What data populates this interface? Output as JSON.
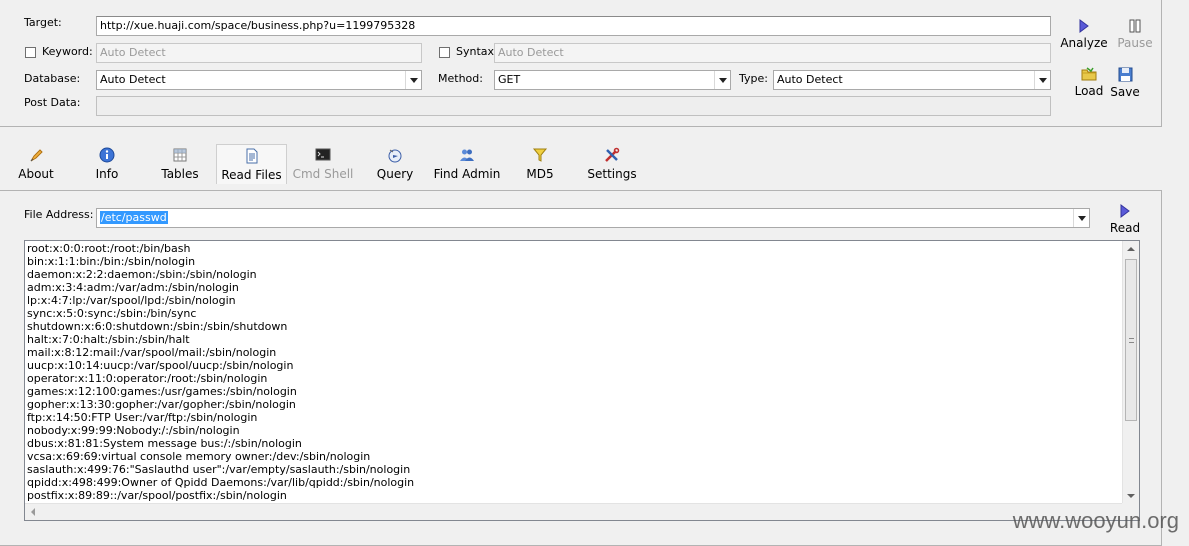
{
  "target": {
    "label": "Target:",
    "value": "http://xue.huaji.com/space/business.php?u=1199795328"
  },
  "keyword": {
    "label": "Keyword:",
    "placeholder": "Auto Detect"
  },
  "syntax": {
    "label": "Syntax:",
    "placeholder": "Auto Detect"
  },
  "database": {
    "label": "Database:",
    "value": "Auto Detect"
  },
  "method": {
    "label": "Method:",
    "value": "GET"
  },
  "type": {
    "label": "Type:",
    "value": "Auto Detect"
  },
  "post_data": {
    "label": "Post Data:",
    "value": ""
  },
  "actions": {
    "analyze": "Analyze",
    "pause": "Pause",
    "load": "Load",
    "save": "Save"
  },
  "toolbar": [
    {
      "label": "About",
      "icon": "about-icon"
    },
    {
      "label": "Info",
      "icon": "info-icon"
    },
    {
      "label": "Tables",
      "icon": "tables-icon"
    },
    {
      "label": "Read Files",
      "icon": "read-files-icon"
    },
    {
      "label": "Cmd Shell",
      "icon": "cmd-shell-icon"
    },
    {
      "label": "Query",
      "icon": "query-icon"
    },
    {
      "label": "Find Admin",
      "icon": "find-admin-icon"
    },
    {
      "label": "MD5",
      "icon": "md5-icon"
    },
    {
      "label": "Settings",
      "icon": "settings-icon"
    }
  ],
  "file_address": {
    "label": "File Address:",
    "value": "/etc/passwd"
  },
  "read_button": "Read",
  "output_lines": [
    "root:x:0:0:root:/root:/bin/bash",
    "bin:x:1:1:bin:/bin:/sbin/nologin",
    "daemon:x:2:2:daemon:/sbin:/sbin/nologin",
    "adm:x:3:4:adm:/var/adm:/sbin/nologin",
    "lp:x:4:7:lp:/var/spool/lpd:/sbin/nologin",
    "sync:x:5:0:sync:/sbin:/bin/sync",
    "shutdown:x:6:0:shutdown:/sbin:/sbin/shutdown",
    "halt:x:7:0:halt:/sbin:/sbin/halt",
    "mail:x:8:12:mail:/var/spool/mail:/sbin/nologin",
    "uucp:x:10:14:uucp:/var/spool/uucp:/sbin/nologin",
    "operator:x:11:0:operator:/root:/sbin/nologin",
    "games:x:12:100:games:/usr/games:/sbin/nologin",
    "gopher:x:13:30:gopher:/var/gopher:/sbin/nologin",
    "ftp:x:14:50:FTP User:/var/ftp:/sbin/nologin",
    "nobody:x:99:99:Nobody:/:/sbin/nologin",
    "dbus:x:81:81:System message bus:/:/sbin/nologin",
    "vcsa:x:69:69:virtual console memory owner:/dev:/sbin/nologin",
    "saslauth:x:499:76:\"Saslauthd user\":/var/empty/saslauth:/sbin/nologin",
    "qpidd:x:498:499:Owner of Qpidd Daemons:/var/lib/qpidd:/sbin/nologin",
    "postfix:x:89:89::/var/spool/postfix:/sbin/nologin"
  ],
  "watermark": "www.wooyun.org"
}
